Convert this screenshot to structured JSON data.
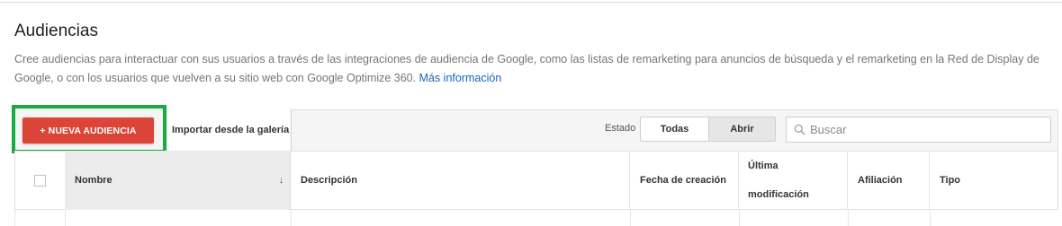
{
  "page": {
    "title": "Audiencias",
    "description": "Cree audiencias para interactuar con sus usuarios a través de las integraciones de audiencia de Google, como las listas de remarketing para anuncios de búsqueda y el remarketing en la Red de Display de Google, o con los usuarios que vuelven a su sitio web con Google Optimize 360.",
    "more_info_link": "Más información"
  },
  "toolbar": {
    "new_audience_button": "+ NUEVA AUDIENCIA",
    "import_gallery": "Importar desde la galería",
    "estado_label": "Estado",
    "filter_todas": "Todas",
    "filter_abrir": "Abrir",
    "filter_selected": "Abrir",
    "search_placeholder": "Buscar",
    "highlight_color": "#1aab40",
    "button_color": "#db4437"
  },
  "table": {
    "columns": [
      "Nombre",
      "Descripción",
      "Fecha de creación",
      "Última",
      "modificación",
      "Afiliación",
      "Tipo"
    ],
    "sorted_column": "Nombre",
    "sort_direction": "descending"
  }
}
